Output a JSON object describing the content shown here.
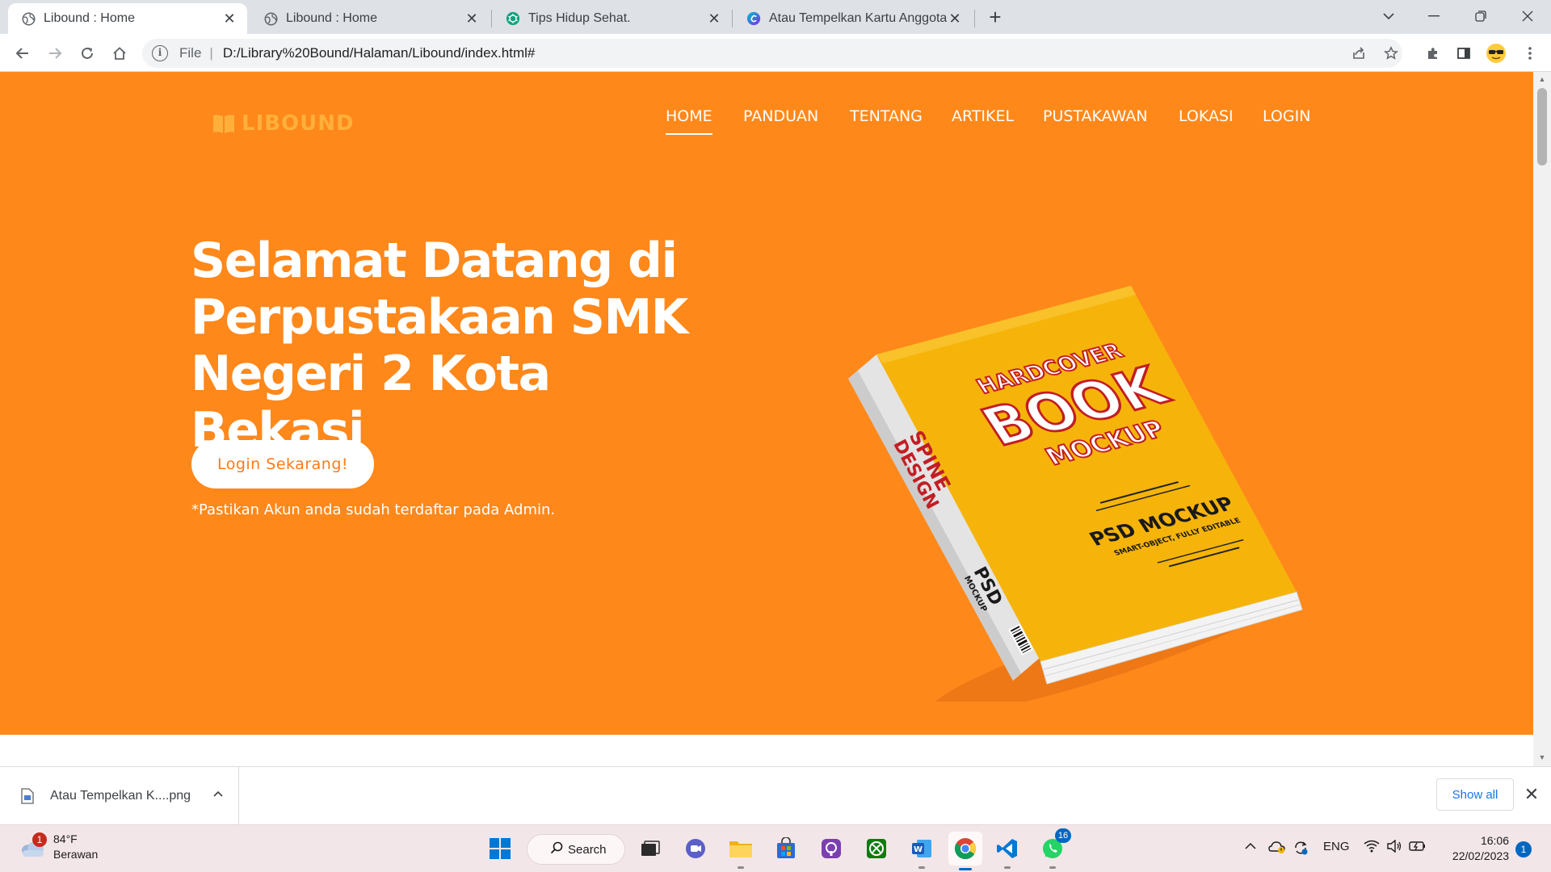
{
  "browser": {
    "tabs": [
      {
        "title": "Libound : Home",
        "active": true,
        "icon": "globe-icon"
      },
      {
        "title": "Libound : Home",
        "active": false,
        "icon": "globe-icon"
      },
      {
        "title": "Tips Hidup Sehat.",
        "active": false,
        "icon": "chatgpt-icon"
      },
      {
        "title": "Atau Tempelkan Kartu Anggota a",
        "active": false,
        "icon": "canva-icon"
      }
    ],
    "address": {
      "scheme_label": "File",
      "url": "D:/Library%20Bound/Halaman/Libound/index.html#"
    }
  },
  "page": {
    "logo_text": "LIBOUND",
    "nav": [
      "HOME",
      "PANDUAN",
      "TENTANG",
      "ARTIKEL",
      "PUSTAKAWAN",
      "LOKASI",
      "LOGIN"
    ],
    "nav_active": "HOME",
    "heading": "Selamat Datang di Perpustakaan SMK Negeri 2 Kota Bekasi",
    "cta_label": "Login Sekarang!",
    "note": "*Pastikan Akun anda sudah terdaftar pada Admin.",
    "book": {
      "line1": "HARDCOVER",
      "line2": "BOOK",
      "line3": "MOCKUP",
      "line4": "PSD MOCKUP",
      "line5": "SMART-OBJECT, FULLY EDITABLE",
      "spine1": "SPINE",
      "spine2": "DESIGN",
      "spine3": "PSD",
      "spine4": "MOCKUP"
    },
    "colors": {
      "hero": "#ff881b",
      "accent": "#ffb03b",
      "book_cover": "#f6b40a"
    }
  },
  "downloads": {
    "file_name": "Atau Tempelkan K....png",
    "show_all": "Show all"
  },
  "taskbar": {
    "weather_temp": "84°F",
    "weather_desc": "Berawan",
    "weather_badge": "1",
    "search_label": "Search",
    "lang": "ENG",
    "time": "16:06",
    "date": "22/02/2023",
    "notification_count": "1",
    "whatsapp_badge": "16"
  }
}
